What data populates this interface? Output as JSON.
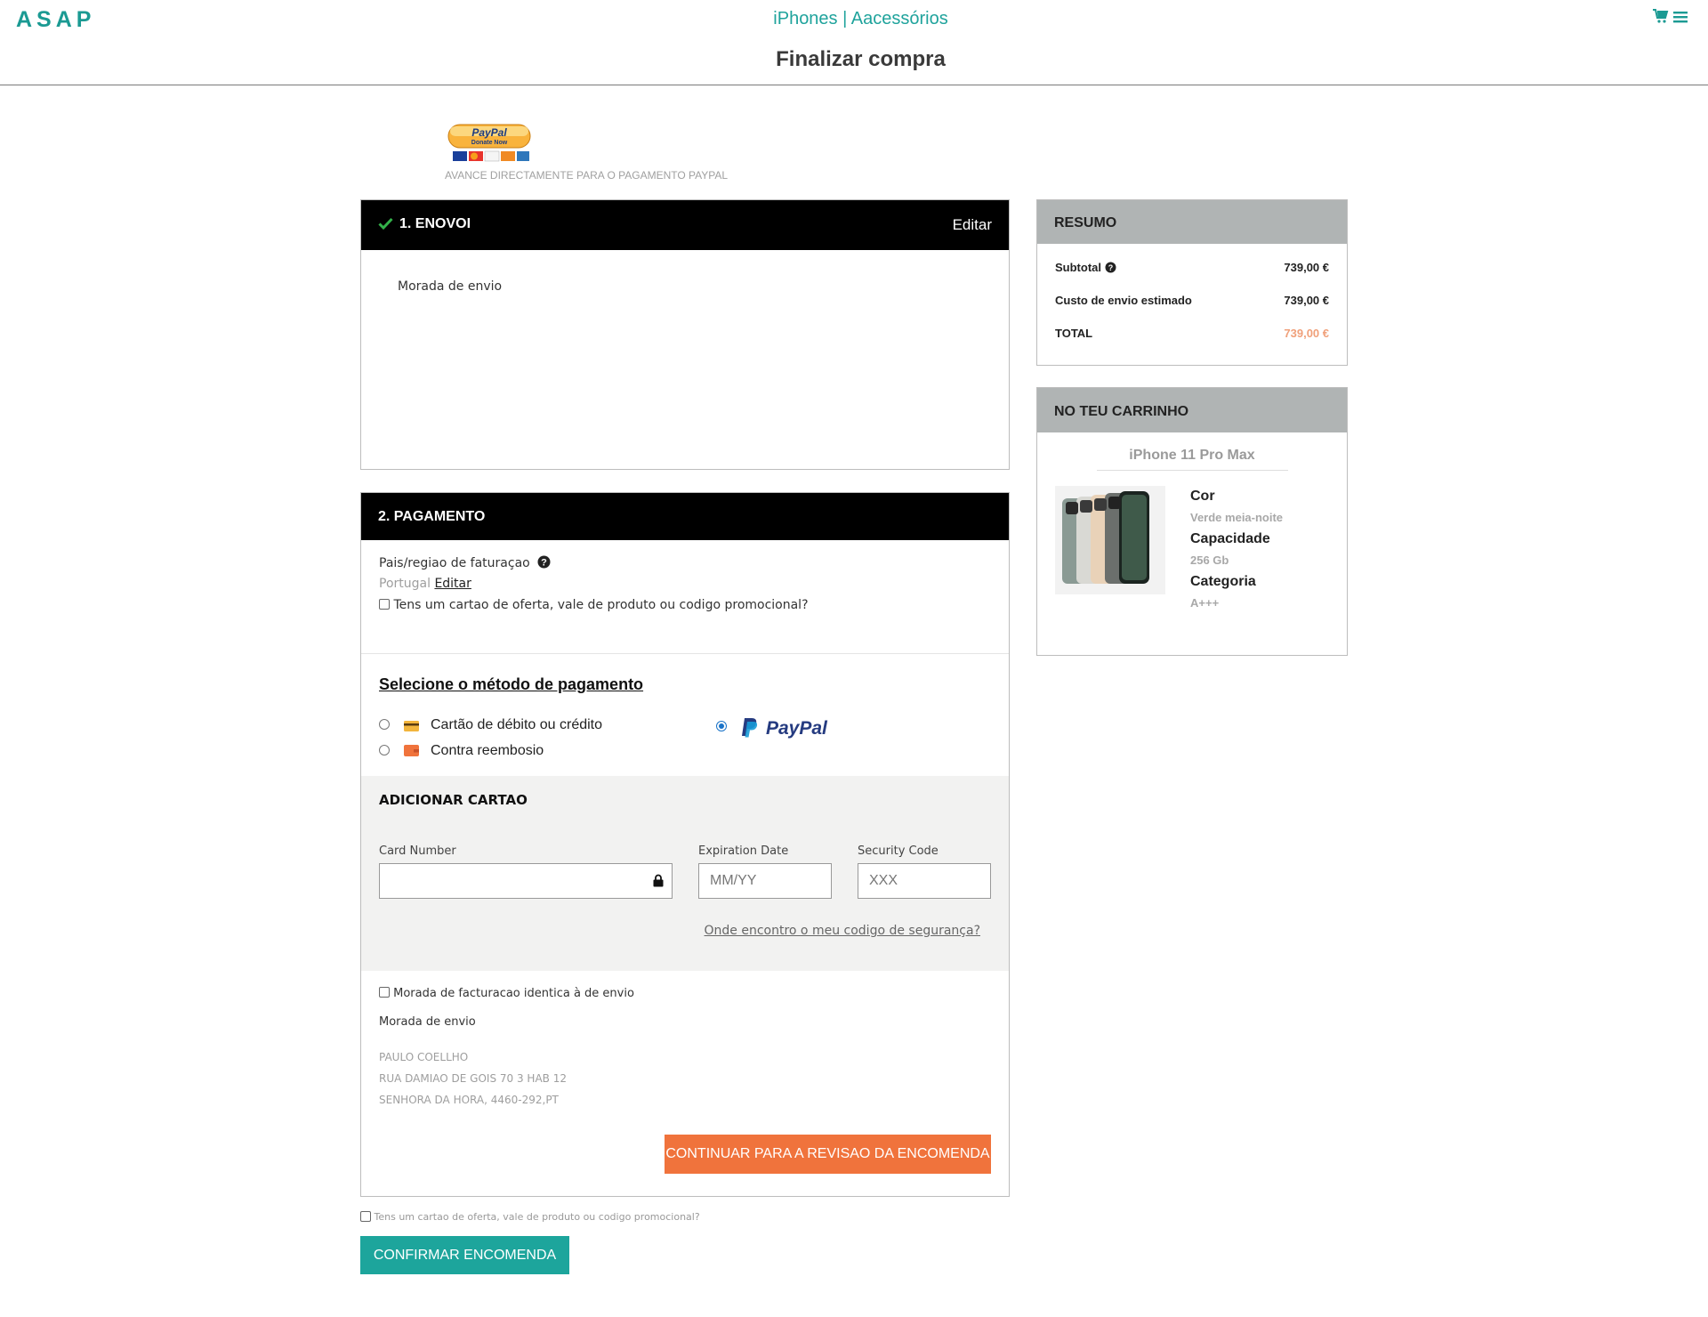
{
  "header": {
    "logo": "ASAP",
    "nav": [
      "iPhones",
      "Aacessórios"
    ],
    "nav_separator": "|",
    "title": "Finalizar compra"
  },
  "paypal_donate": {
    "badge_text": "PayPal",
    "badge_sub": "Donate Now",
    "caption": "AVANCE DIRECTAMENTE PARA O PAGAMENTO PAYPAL"
  },
  "shipping": {
    "title": "1. ENOVOI",
    "edit": "Editar",
    "address_label": "Morada de envio"
  },
  "payment": {
    "title": "2. PAGAMENTO",
    "country_label": "Pais/regiao de faturaçao",
    "country_value": "Portugal",
    "country_edit": "Editar",
    "gift_card_label": "Tens um cartao de oferta, vale de produto ou codigo promocional?",
    "method_heading": "Selecione o método de pagamento",
    "methods": [
      {
        "label": "Cartão de débito ou crédito",
        "selected": false
      },
      {
        "label": "Contra reembosio",
        "selected": false
      },
      {
        "label": "PayPal",
        "selected": true
      }
    ],
    "add_card": {
      "heading": "ADICIONAR CARTAO",
      "card_number_label": "Card Number",
      "card_number_value": "",
      "expiry_label": "Expiration Date",
      "expiry_placeholder": "MM/YY",
      "cvc_label": "Security Code",
      "cvc_placeholder": "XXX",
      "help_link": "Onde encontro o meu codigo de segurança?"
    },
    "same_address_label": "Morada de facturacao identica à de envio",
    "address_label": "Morada de envio",
    "address_lines": [
      "PAULO COELLHO",
      "RUA DAMIAO DE GOIS 70 3 HAB 12",
      "SENHORA DA HORA, 4460-292,PT"
    ],
    "continue_button": "CONTINUAR PARA A REVISAO DA ENCOMENDA"
  },
  "footer": {
    "gift_card_label": "Tens um cartao de oferta, vale de produto ou codigo promocional?",
    "confirm_button": "CONFIRMAR ENCOMENDA"
  },
  "summary": {
    "title": "RESUMO",
    "rows": [
      {
        "label": "Subtotal",
        "value": "739,00 €"
      },
      {
        "label": "Custo de envio estimado",
        "value": "739,00 €"
      },
      {
        "label": "TOTAL",
        "value": "739,00 €"
      }
    ],
    "total_color": "#f0a07a"
  },
  "cart": {
    "title": "NO TEU CARRINHO",
    "product_name": "iPhone 11 Pro Max",
    "attributes": [
      {
        "label": "Cor",
        "value": "Verde meia-noite"
      },
      {
        "label": "Capacidade",
        "value": "256 Gb"
      },
      {
        "label": "Categoria",
        "value": "A+++"
      }
    ]
  },
  "colors": {
    "accent_teal": "#1da59c",
    "accent_orange": "#f0733c",
    "paypal_blue": "#253b80",
    "paypal_light_blue": "#179bd7"
  }
}
